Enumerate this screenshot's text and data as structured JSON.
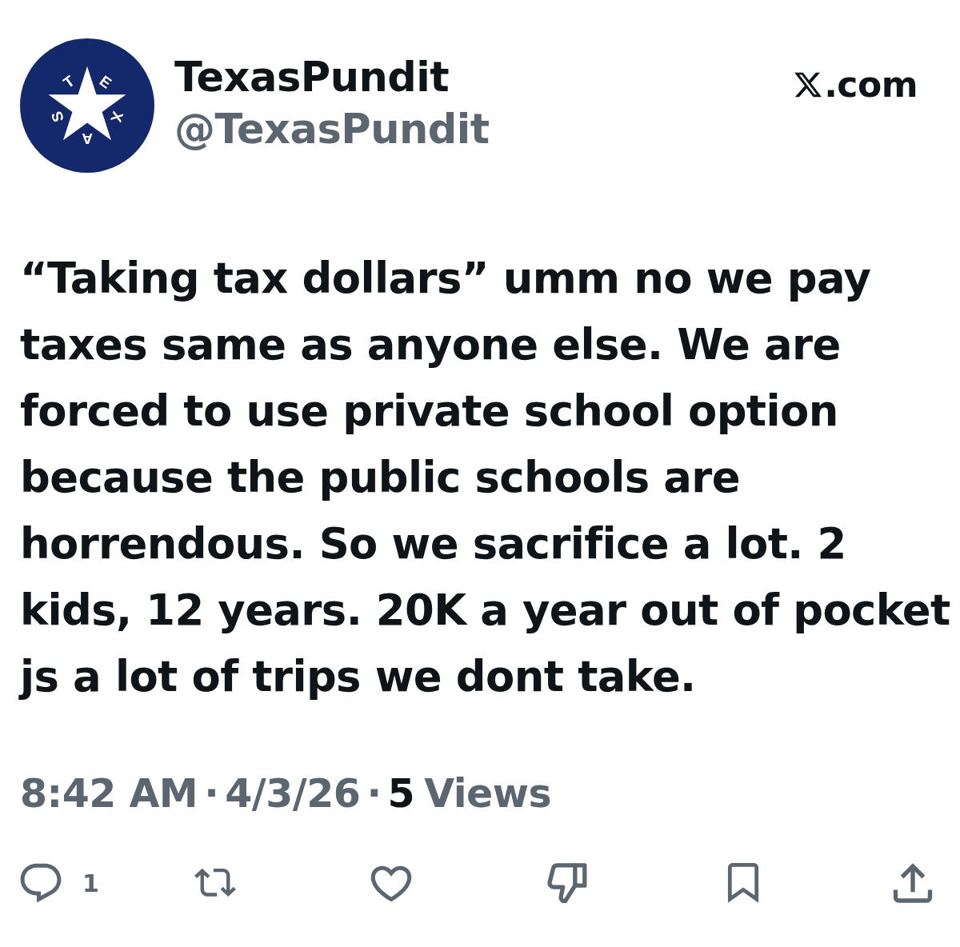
{
  "author": {
    "name": "TexasPundit",
    "handle": "@TexasPundit",
    "avatar_letters": [
      "T",
      "E",
      "X",
      "A",
      "S"
    ]
  },
  "source": {
    "label": ".com"
  },
  "post": {
    "text": "“Taking tax dollars” umm no we pay taxes same as anyone else. We are forced to use private school option because the public schools are horrendous. So we sacrifice a lot. 2 kids, 12 years. 20K a year out of pocket js a lot of trips we dont take."
  },
  "meta": {
    "time": "8:42 AM",
    "date": "4/3/26",
    "views_count": "5",
    "views_label": "Views",
    "separators": [
      "·",
      "·"
    ]
  },
  "actions": [
    {
      "kind": "reply",
      "count": "1"
    },
    {
      "kind": "repost"
    },
    {
      "kind": "like"
    },
    {
      "kind": "dislike"
    },
    {
      "kind": "bookmark"
    },
    {
      "kind": "share"
    }
  ]
}
